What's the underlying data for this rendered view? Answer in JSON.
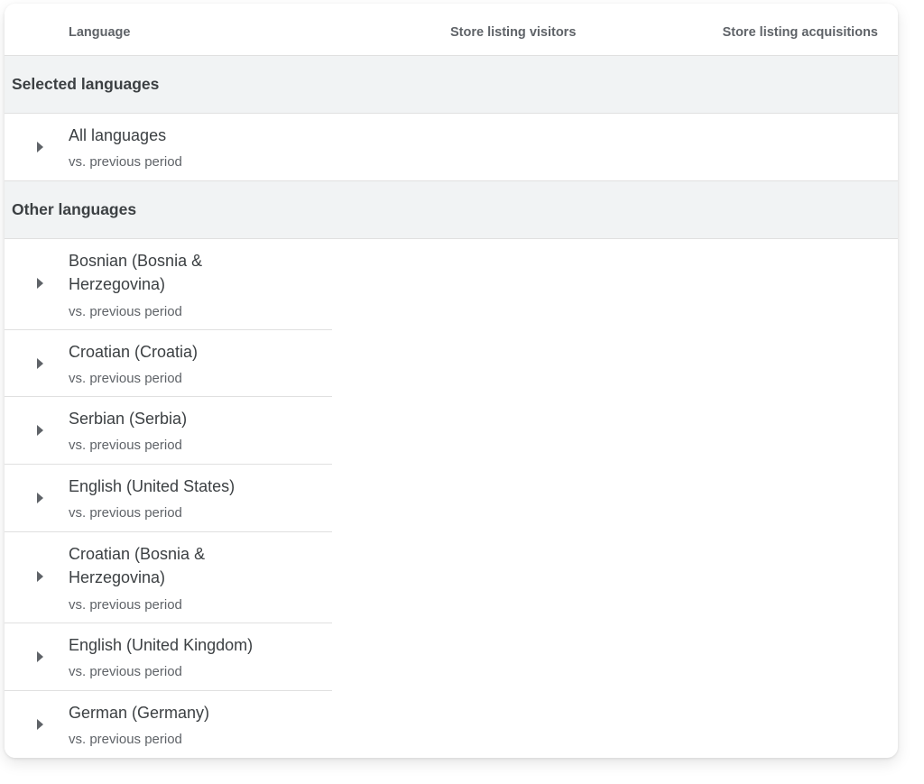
{
  "table": {
    "columns": {
      "language": "Language",
      "visitors": "Store listing visitors",
      "acquisitions": "Store listing acquisitions"
    },
    "sections": {
      "selected": "Selected languages",
      "other": "Other languages"
    },
    "comparison_label": "vs. previous period",
    "selected_rows": [
      {
        "name_lines": [
          "All languages"
        ]
      }
    ],
    "other_rows": [
      {
        "name_lines": [
          "Bosnian (Bosnia &",
          "Herzegovina)"
        ]
      },
      {
        "name_lines": [
          "Croatian (Croatia)"
        ]
      },
      {
        "name_lines": [
          "Serbian (Serbia)"
        ]
      },
      {
        "name_lines": [
          "English (United States)"
        ]
      },
      {
        "name_lines": [
          "Croatian (Bosnia &",
          "Herzegovina)"
        ]
      },
      {
        "name_lines": [
          "English (United Kingdom)"
        ]
      },
      {
        "name_lines": [
          "German (Germany)"
        ]
      }
    ],
    "icons": {
      "row_expand": "caret-right-icon"
    },
    "colors": {
      "section_bg": "#f1f3f4",
      "divider": "#e0e0e0",
      "muted_text": "#5f6368",
      "primary_text": "#3c4043"
    }
  }
}
